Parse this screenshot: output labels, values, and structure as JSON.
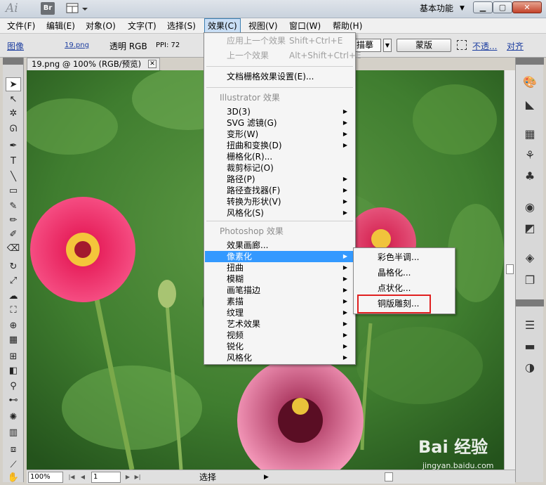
{
  "titlebar": {
    "app_logo": "Ai",
    "bridge_button": "Br",
    "workspace": "基本功能",
    "min_label": "▁",
    "max_label": "▢",
    "close_label": "✕"
  },
  "menubar": {
    "items": [
      "文件(F)",
      "编辑(E)",
      "对象(O)",
      "文字(T)",
      "选择(S)",
      "效果(C)",
      "视图(V)",
      "窗口(W)",
      "帮助(H)"
    ]
  },
  "controlbar": {
    "image_label": "图像",
    "file_link": "19.png",
    "transparent_label": "透明 RGB",
    "ppi_label": "PPI: 72",
    "trace_label": "描摹",
    "mask_button": "蒙版",
    "opacity_label": "不透...",
    "align_label": "对齐"
  },
  "document": {
    "tab_title": "19.png @ 100% (RGB/预览)",
    "tab_close": "✕"
  },
  "statusbar": {
    "zoom": "100%",
    "page": "1",
    "mode": "选择"
  },
  "effect_menu": {
    "apply_last": "应用上一个效果",
    "apply_last_shortcut": "Shift+Ctrl+E",
    "last_effect": "上一个效果",
    "last_effect_shortcut": "Alt+Shift+Ctrl+E",
    "raster_settings": "文档栅格效果设置(E)...",
    "illustrator_header": "Illustrator 效果",
    "illustrator_items": [
      "3D(3)",
      "SVG 滤镜(G)",
      "变形(W)",
      "扭曲和变换(D)",
      "栅格化(R)...",
      "裁剪标记(O)",
      "路径(P)",
      "路径查找器(F)",
      "转换为形状(V)",
      "风格化(S)"
    ],
    "photoshop_header": "Photoshop 效果",
    "photoshop_items": [
      "效果画廊...",
      "像素化",
      "扭曲",
      "模糊",
      "画笔描边",
      "素描",
      "纹理",
      "艺术效果",
      "视频",
      "锐化",
      "风格化"
    ]
  },
  "pixelate_submenu": {
    "items": [
      "彩色半调...",
      "晶格化...",
      "点状化...",
      "铜版雕刻..."
    ]
  },
  "watermark": {
    "logo": "Bai 经验",
    "url": "jingyan.baidu.com"
  },
  "colors": {
    "menu_highlight": "#3399ff",
    "red_box": "#e02020"
  }
}
